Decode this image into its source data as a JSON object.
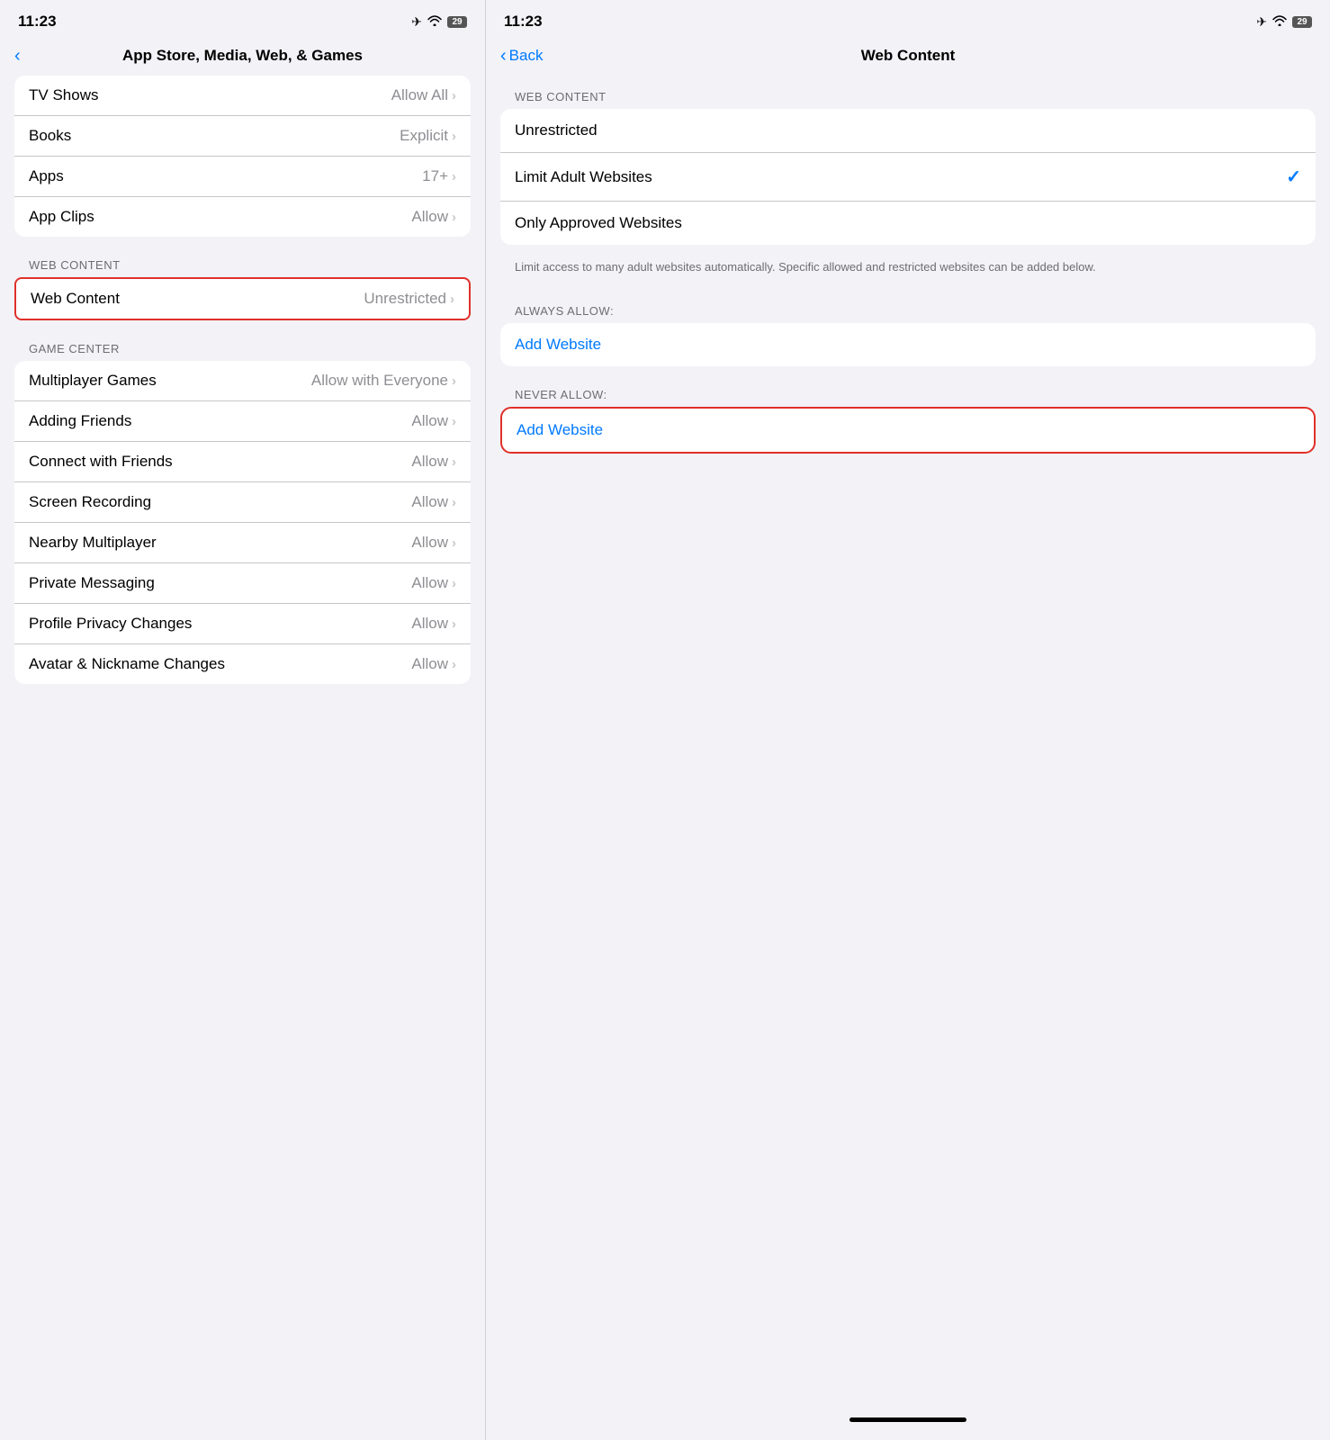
{
  "left": {
    "statusBar": {
      "time": "11:23",
      "batteryLevel": "29"
    },
    "navHeader": {
      "backChevron": "‹",
      "title": "App Store, Media, Web, & Games"
    },
    "contentItems": [
      {
        "label": "TV Shows",
        "value": "Allow All"
      },
      {
        "label": "Books",
        "value": "Explicit"
      },
      {
        "label": "Apps",
        "value": "17+"
      },
      {
        "label": "App Clips",
        "value": "Allow"
      }
    ],
    "webContentSection": {
      "sectionLabel": "WEB CONTENT",
      "item": {
        "label": "Web Content",
        "value": "Unrestricted"
      }
    },
    "gameCenterSection": {
      "sectionLabel": "GAME CENTER",
      "items": [
        {
          "label": "Multiplayer Games",
          "value": "Allow with Everyone"
        },
        {
          "label": "Adding Friends",
          "value": "Allow"
        },
        {
          "label": "Connect with Friends",
          "value": "Allow"
        },
        {
          "label": "Screen Recording",
          "value": "Allow"
        },
        {
          "label": "Nearby Multiplayer",
          "value": "Allow"
        },
        {
          "label": "Private Messaging",
          "value": "Allow"
        },
        {
          "label": "Profile Privacy Changes",
          "value": "Allow"
        },
        {
          "label": "Avatar & Nickname Changes",
          "value": "Allow"
        }
      ]
    }
  },
  "right": {
    "statusBar": {
      "time": "11:23",
      "batteryLevel": "29"
    },
    "navHeader": {
      "backLabel": "Back",
      "title": "Web Content"
    },
    "webContentSection": {
      "sectionLabel": "WEB CONTENT",
      "options": [
        {
          "label": "Unrestricted",
          "checked": false
        },
        {
          "label": "Limit Adult Websites",
          "checked": true
        },
        {
          "label": "Only Approved Websites",
          "checked": false
        }
      ],
      "description": "Limit access to many adult websites automatically. Specific allowed and restricted websites can be added below."
    },
    "alwaysAllow": {
      "sectionLabel": "ALWAYS ALLOW:",
      "addWebsite": "Add Website"
    },
    "neverAllow": {
      "sectionLabel": "NEVER ALLOW:",
      "addWebsite": "Add Website"
    }
  },
  "icons": {
    "chevronRight": "›",
    "checkmark": "✓",
    "airplane": "✈",
    "wifi": "wifi",
    "back": "‹"
  }
}
